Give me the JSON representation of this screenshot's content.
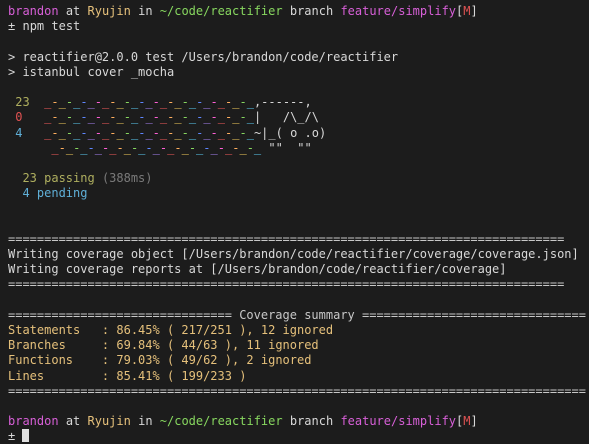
{
  "prompt": {
    "user": "brandon",
    "at": "at",
    "host": "Ryujin",
    "in": "in",
    "path": "~/code/reactifier",
    "branch_word": "branch",
    "branch": "feature/simplify",
    "status_open": "[",
    "status": "M",
    "status_close": "]",
    "symbol": "±"
  },
  "command": "npm test",
  "npm_lines": [
    "> reactifier@2.0.0 test /Users/brandon/code/reactifier",
    "> istanbul cover _mocha"
  ],
  "nyan": {
    "passing_count": "23",
    "failing_count": "0",
    "pending_count": "4",
    "cat_row1": ",------,",
    "cat_row2": "|   /\\_/\\",
    "cat_row3": "~|_( o .o)",
    "cat_row4": "\"\"  \"\""
  },
  "results": {
    "passing": "23 passing",
    "duration": "(388ms)",
    "pending": "4 pending"
  },
  "coverage_block": {
    "rule": "=============================================================================",
    "writing1": "Writing coverage object [/Users/brandon/code/reactifier/coverage/coverage.json]",
    "writing2": "Writing coverage reports at [/Users/brandon/code/reactifier/coverage]"
  },
  "summary": {
    "header": "=============================== Coverage summary ===============================",
    "rows": [
      {
        "label": "Statements   ",
        "value": ": 86.45% ( 217/251 ), 12 ignored"
      },
      {
        "label": "Branches     ",
        "value": ": 69.84% ( 44/63 ), 11 ignored"
      },
      {
        "label": "Functions    ",
        "value": ": 79.03% ( 49/62 ), 2 ignored"
      },
      {
        "label": "Lines        ",
        "value": ": 85.41% ( 199/233 )"
      }
    ],
    "footer": "================================================================================"
  },
  "colors": {
    "background": "#1c1c1c",
    "user": "#d75fd7",
    "host": "#e5c07b",
    "path": "#87d75f",
    "branch": "#d75fd7",
    "dirty": "#e05252",
    "coverage": "#e5c07b"
  }
}
